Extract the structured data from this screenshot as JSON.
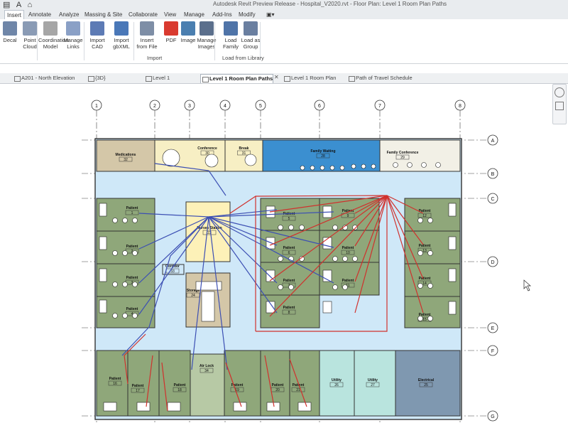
{
  "app": {
    "title": "Autodesk Revit Preview Release - Hospital_V2020.rvt - Floor Plan: Level 1 Room Plan Paths",
    "quick_access": "▤ A ⌂"
  },
  "ribbon_tabs": [
    "Insert",
    "Annotate",
    "Analyze",
    "Massing & Site",
    "Collaborate",
    "View",
    "Manage",
    "Add-Ins",
    "Modify"
  ],
  "ribbon": {
    "buttons": [
      {
        "label": "Decal",
        "icon": "decal-icon"
      },
      {
        "label": "Point Cloud",
        "icon": "point-cloud-icon"
      },
      {
        "label": "Coordination Model",
        "icon": "coordination-model-icon"
      },
      {
        "label": "Manage Links",
        "icon": "manage-links-icon"
      },
      {
        "label": "Import CAD",
        "icon": "import-cad-icon"
      },
      {
        "label": "Import gbXML",
        "icon": "import-gbxml-icon"
      },
      {
        "label": "Insert from File",
        "icon": "insert-from-file-icon"
      },
      {
        "label": "PDF",
        "icon": "pdf-icon"
      },
      {
        "label": "Image",
        "icon": "image-icon"
      },
      {
        "label": "Manage Images",
        "icon": "manage-images-icon"
      },
      {
        "label": "Load Family",
        "icon": "load-family-icon"
      },
      {
        "label": "Load as Group",
        "icon": "load-as-group-icon"
      }
    ],
    "groups": [
      "Import",
      "Load from Library"
    ]
  },
  "view_tabs": [
    {
      "label": "A201 - North Elevation",
      "active": false
    },
    {
      "label": "{3D}",
      "active": false
    },
    {
      "label": "Level 1",
      "active": false
    },
    {
      "label": "Level 1 Room Plan Paths",
      "active": true
    },
    {
      "label": "Level 1 Room Plan",
      "active": false
    },
    {
      "label": "Path of Travel Schedule",
      "active": false
    }
  ],
  "grid": {
    "columns": [
      "1",
      "2",
      "3",
      "4",
      "5",
      "6",
      "7",
      "8"
    ],
    "rows": [
      "A",
      "B",
      "C",
      "D",
      "E",
      "F",
      "G"
    ]
  },
  "rooms": [
    {
      "name": "Medications",
      "number": "32"
    },
    {
      "name": "Conference",
      "number": "30"
    },
    {
      "name": "Break",
      "number": "31"
    },
    {
      "name": "Family Waiting",
      "number": "28"
    },
    {
      "name": "Family Conference",
      "number": "29"
    },
    {
      "name": "Nurses Station",
      "number": "23"
    },
    {
      "name": "Corridor",
      "number": "33"
    },
    {
      "name": "Storage",
      "number": "24"
    },
    {
      "name": "Air Lock",
      "number": "34"
    },
    {
      "name": "Utility",
      "number": "26"
    },
    {
      "name": "Utility",
      "number": "27"
    },
    {
      "name": "Electrical",
      "number": "25"
    },
    {
      "name": "Patient",
      "number": "1"
    },
    {
      "name": "Patient",
      "number": "2"
    },
    {
      "name": "Patient",
      "number": "3"
    },
    {
      "name": "Patient",
      "number": "4"
    },
    {
      "name": "Patient",
      "number": "5"
    },
    {
      "name": "Patient",
      "number": "6"
    },
    {
      "name": "Patient",
      "number": "7"
    },
    {
      "name": "Patient",
      "number": "8"
    },
    {
      "name": "Patient",
      "number": "9"
    },
    {
      "name": "Patient",
      "number": "10"
    },
    {
      "name": "Patient",
      "number": "11"
    },
    {
      "name": "Patient",
      "number": "12"
    },
    {
      "name": "Patient",
      "number": "13"
    },
    {
      "name": "Patient",
      "number": "14"
    },
    {
      "name": "Patient",
      "number": "15"
    },
    {
      "name": "Patient",
      "number": "16"
    },
    {
      "name": "Patient",
      "number": "17"
    },
    {
      "name": "Patient",
      "number": "18"
    },
    {
      "name": "Patient",
      "number": "19"
    },
    {
      "name": "Patient",
      "number": "20"
    },
    {
      "name": "Patient",
      "number": "21"
    },
    {
      "name": "Patient",
      "number": "22"
    }
  ],
  "colors": {
    "patient": "#8fa77a",
    "corridor": "#cfe8f8",
    "nurses": "#fdf1b8",
    "family_waiting": "#3b8fd0",
    "conference": "#f7efc4",
    "medications": "#d4c7a8",
    "utility": "#b9e4de",
    "electrical": "#7f98b0",
    "path_red": "#d0312d",
    "path_blue": "#3c4fb3"
  }
}
